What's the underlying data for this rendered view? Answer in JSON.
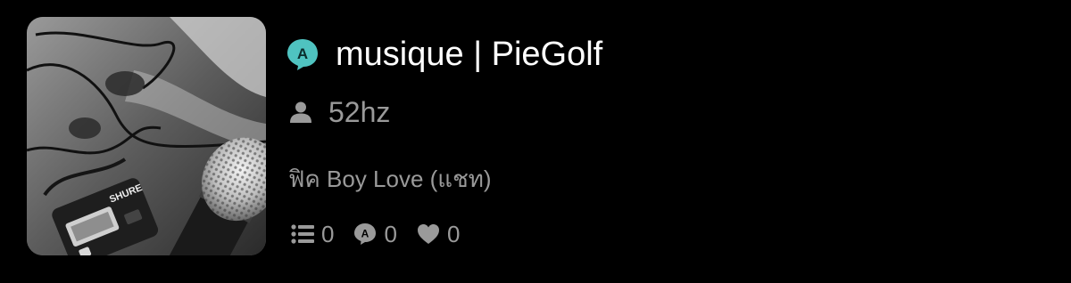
{
  "story": {
    "title": "musique | PieGolf",
    "author": "52hz",
    "tag": "ฟิค Boy Love (แชท)",
    "cover_alt": "cover-image",
    "app_badge_letter": "A"
  },
  "stats": {
    "chapters": "0",
    "comments": "0",
    "likes": "0"
  },
  "colors": {
    "background": "#000000",
    "title": "#ffffff",
    "muted": "#9a9a9a",
    "badge": "#4fc3c0"
  }
}
